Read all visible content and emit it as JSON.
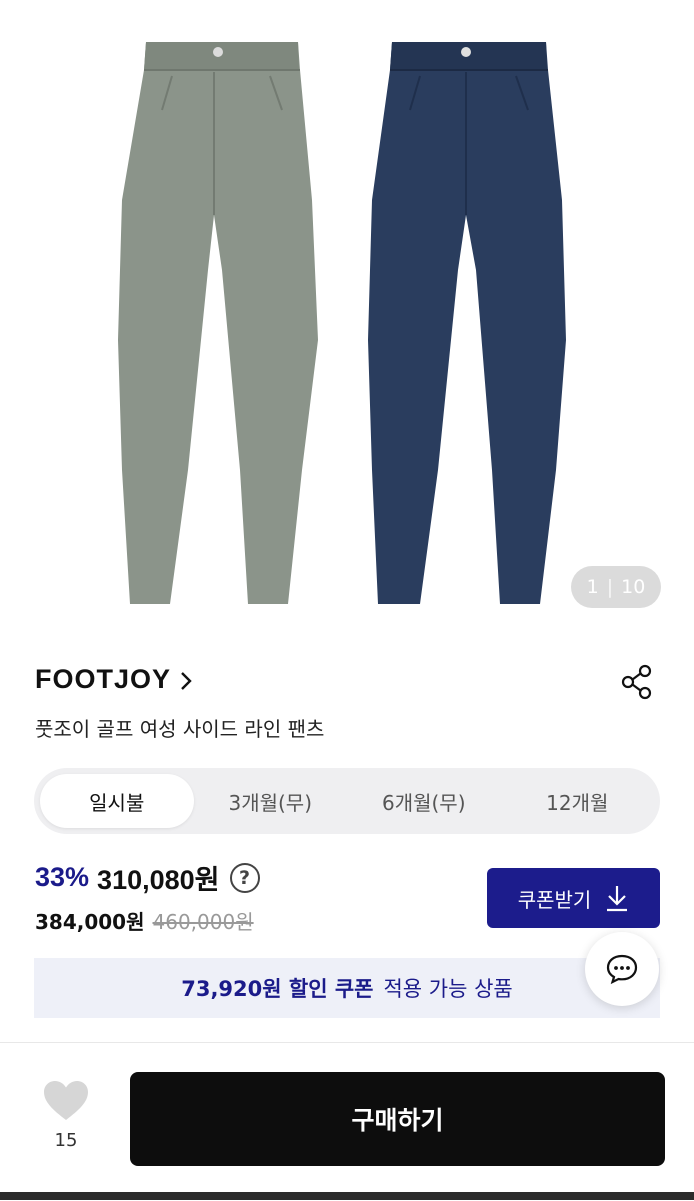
{
  "gallery": {
    "current": "1",
    "separator": "|",
    "total": "10",
    "colors": {
      "gray_pants": "#8b948a",
      "navy_pants": "#2a3d5e"
    }
  },
  "product": {
    "brand": "FOOTJOY",
    "title": "풋조이 골프 여성 사이드 라인 팬츠"
  },
  "payment_tabs": [
    "일시불",
    "3개월(무)",
    "6개월(무)",
    "12개월"
  ],
  "pricing": {
    "discount": "33%",
    "price": "310,080원",
    "help_icon": "?",
    "base_price": "384,000원",
    "original_price": "460,000원"
  },
  "coupon_button": {
    "label": "쿠폰받기"
  },
  "coupon_banner": {
    "strong": "73,920원 할인 쿠폰",
    "rest": "적용 가능 상품"
  },
  "bottom": {
    "like_count": "15",
    "buy_label": "구매하기"
  },
  "colors": {
    "accent": "#1c1c8c",
    "buy": "#0d0d0d"
  }
}
